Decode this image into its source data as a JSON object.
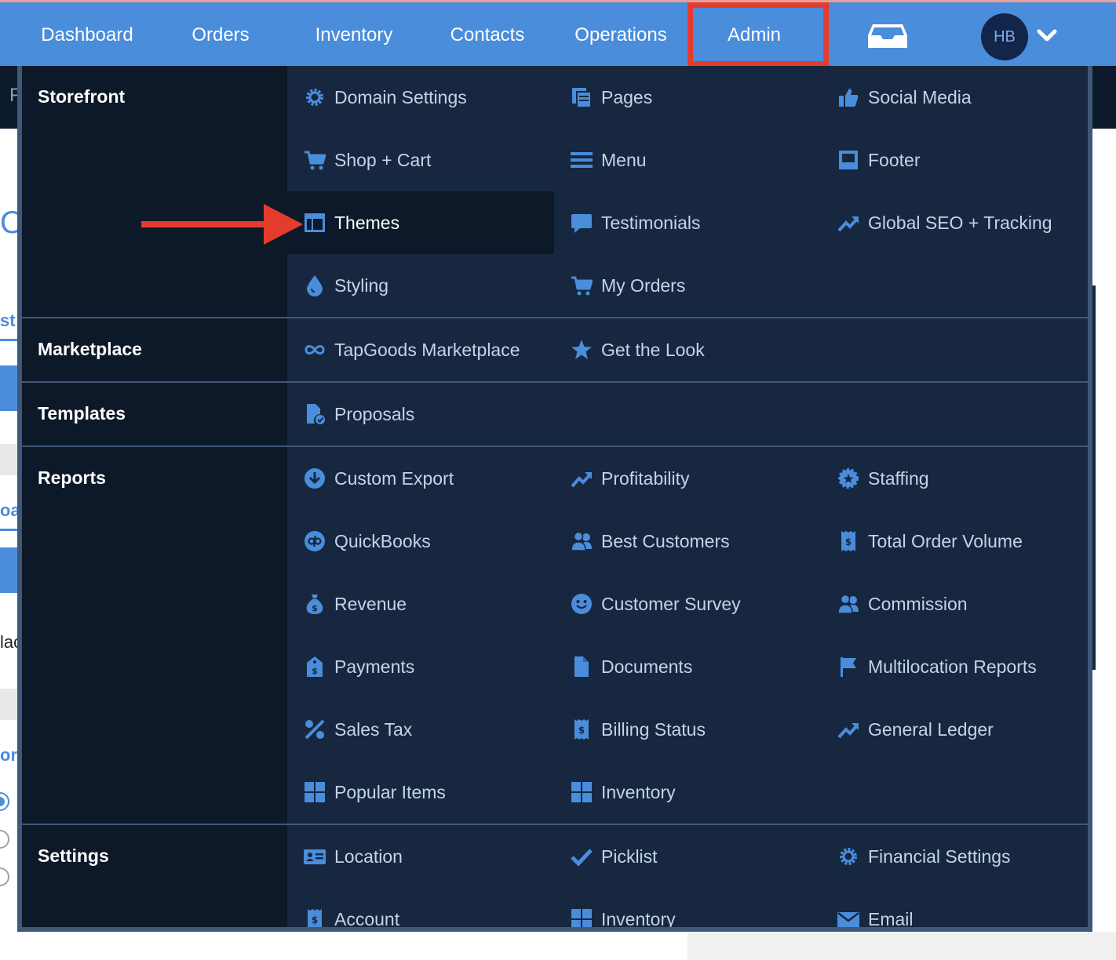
{
  "topnav": {
    "items": [
      "Dashboard",
      "Orders",
      "Inventory",
      "Contacts",
      "Operations",
      "Admin"
    ],
    "avatar_initials": "HB",
    "inbox_icon": "inbox-icon",
    "menu_icon": "chevron-down-icon"
  },
  "background": {
    "bar_letter": "F",
    "fragments": [
      "O",
      "st",
      "oa",
      "lac",
      "ort"
    ]
  },
  "menu": {
    "storefront": {
      "title": "Storefront",
      "items": [
        "Domain Settings",
        "Pages",
        "Social Media",
        "Shop + Cart",
        "Menu",
        "Footer",
        "Themes",
        "Testimonials",
        "Global SEO + Tracking",
        "Styling",
        "My Orders"
      ]
    },
    "marketplace": {
      "title": "Marketplace",
      "items": [
        "TapGoods Marketplace",
        "Get the Look"
      ]
    },
    "templates": {
      "title": "Templates",
      "items": [
        "Proposals"
      ]
    },
    "reports": {
      "title": "Reports",
      "items": [
        "Custom Export",
        "Profitability",
        "Staffing",
        "QuickBooks",
        "Best Customers",
        "Total Order Volume",
        "Revenue",
        "Customer Survey",
        "Commission",
        "Payments",
        "Documents",
        "Multilocation Reports",
        "Sales Tax",
        "Billing Status",
        "General Ledger",
        "Popular Items",
        "Inventory"
      ]
    },
    "settings": {
      "title": "Settings",
      "items": [
        "Location",
        "Picklist",
        "Financial Settings",
        "Account",
        "Inventory",
        "Email"
      ]
    }
  },
  "colors": {
    "nav_bg": "#4a8ddb",
    "panel_bg": "#16273f",
    "label_bg": "#0d1828",
    "icon": "#4a8ddb",
    "highlight_box": "#e53b2d",
    "arrow": "#e53b2d"
  }
}
